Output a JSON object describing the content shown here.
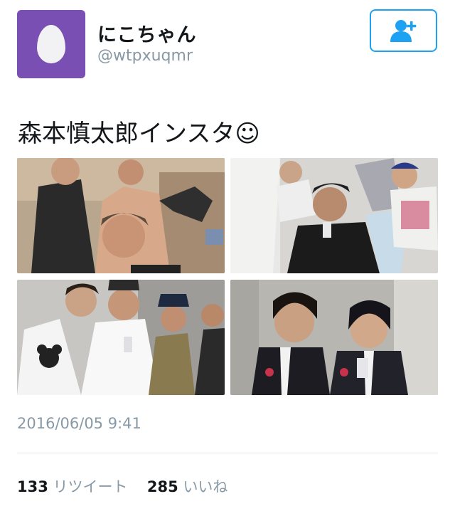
{
  "user": {
    "display_name": "にこちゃん",
    "handle": "@wtpxuqmr",
    "avatar_icon": "egg-avatar-icon",
    "avatar_color": "#7a4fb4"
  },
  "follow_button": {
    "icon": "follow-person-plus-icon",
    "accent_color": "#1da1f2"
  },
  "tweet": {
    "text": "森本慎太郎インスタ☺",
    "timestamp": "2016/06/05 9:41"
  },
  "stats": {
    "retweets_count": "133",
    "retweets_label": "リツイート",
    "likes_count": "285",
    "likes_label": "いいね"
  }
}
